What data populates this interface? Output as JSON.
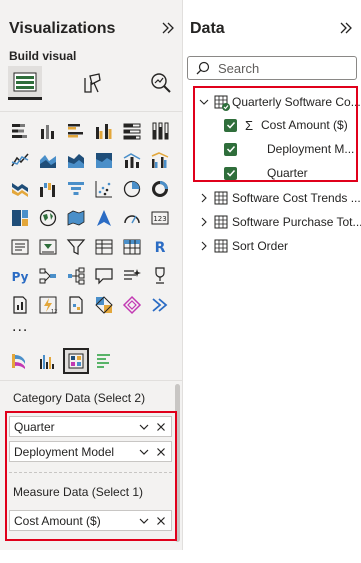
{
  "visualizations": {
    "title": "Visualizations",
    "build_visual_label": "Build visual",
    "tabs": [
      "build-visual-tab",
      "format-visual-tab",
      "analytics-tab"
    ],
    "more_label": "...",
    "wells": {
      "category_label": "Category Data (Select 2)",
      "category_items": [
        "Quarter",
        "Deployment Model"
      ],
      "measure_label": "Measure Data (Select 1)",
      "measure_items": [
        "Cost Amount ($)"
      ]
    }
  },
  "data": {
    "title": "Data",
    "search_placeholder": "Search",
    "tables": [
      {
        "name": "Quarterly Software Co...",
        "expanded": true,
        "fields": [
          {
            "label": "Cost Amount ($)",
            "sigma": true,
            "checked": true
          },
          {
            "label": "Deployment M...",
            "sigma": false,
            "checked": true
          },
          {
            "label": "Quarter",
            "sigma": false,
            "checked": true
          }
        ]
      },
      {
        "name": "Software Cost Trends ...",
        "expanded": false
      },
      {
        "name": "Software Purchase Tot...",
        "expanded": false
      },
      {
        "name": "Sort Order",
        "expanded": false
      }
    ]
  },
  "colors": {
    "highlight_border": "#e0001b",
    "checkbox": "#2f6e3b",
    "pane_bg": "#f3f2f1"
  }
}
